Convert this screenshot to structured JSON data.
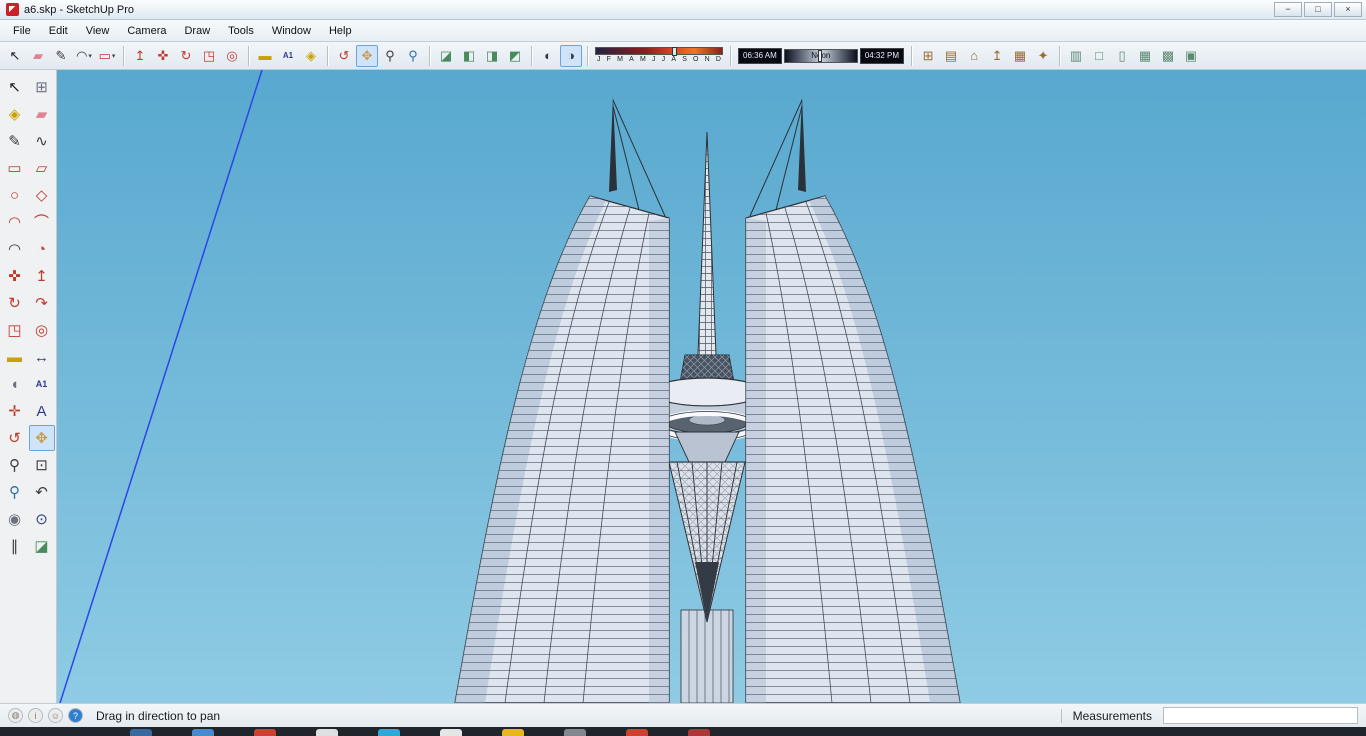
{
  "window": {
    "title": "a6.skp - SketchUp Pro",
    "controls": [
      {
        "name": "minimize",
        "glyph": "−"
      },
      {
        "name": "maximize",
        "glyph": "□"
      },
      {
        "name": "close",
        "glyph": "×"
      }
    ]
  },
  "menu": {
    "items": [
      "File",
      "Edit",
      "View",
      "Camera",
      "Draw",
      "Tools",
      "Window",
      "Help"
    ]
  },
  "toolbar_top": {
    "groups": [
      {
        "type": "buttons",
        "name": "draw",
        "buttons": [
          {
            "name": "select",
            "glyph": "↖",
            "color": "#1b1b1b"
          },
          {
            "name": "eraser",
            "glyph": "▰",
            "color": "#e08394"
          },
          {
            "name": "line",
            "glyph": "✎",
            "color": "#3a3a3a"
          },
          {
            "name": "arcs",
            "glyph": "◠",
            "color": "#3a3a3a",
            "dropdown": true
          },
          {
            "name": "shapes",
            "glyph": "▭",
            "color": "#c0392b",
            "dropdown": true
          }
        ]
      },
      {
        "type": "buttons",
        "name": "modify",
        "buttons": [
          {
            "name": "push-pull",
            "glyph": "↥",
            "color": "#c0392b"
          },
          {
            "name": "move",
            "glyph": "✜",
            "color": "#c0392b"
          },
          {
            "name": "rotate",
            "glyph": "↻",
            "color": "#c0392b"
          },
          {
            "name": "scale",
            "glyph": "◳",
            "color": "#c0392b"
          },
          {
            "name": "offset",
            "glyph": "◎",
            "color": "#c0392b"
          }
        ]
      },
      {
        "type": "buttons",
        "name": "construction",
        "buttons": [
          {
            "name": "tape-measure",
            "glyph": "▬",
            "color": "#c8a200"
          },
          {
            "name": "text",
            "glyph": "A1",
            "color": "#2d3b8e"
          },
          {
            "name": "paint-bucket",
            "glyph": "◈",
            "color": "#c8a200"
          }
        ]
      },
      {
        "type": "buttons",
        "name": "camera",
        "buttons": [
          {
            "name": "orbit",
            "glyph": "↺",
            "color": "#c0392b"
          },
          {
            "name": "pan",
            "glyph": "✥",
            "color": "#c99a4e",
            "active": true
          },
          {
            "name": "zoom",
            "glyph": "⚲",
            "color": "#3a3a3a"
          },
          {
            "name": "zoom-extents",
            "glyph": "⚲",
            "color": "#2d6cb0"
          }
        ]
      },
      {
        "type": "buttons",
        "name": "section",
        "buttons": [
          {
            "name": "section-plane",
            "glyph": "◪",
            "color": "#4a8a5c"
          },
          {
            "name": "display-section-planes",
            "glyph": "◧",
            "color": "#4a8a5c"
          },
          {
            "name": "display-section-cuts",
            "glyph": "◨",
            "color": "#4a8a5c"
          },
          {
            "name": "display-section-fill",
            "glyph": "◩",
            "color": "#4a8a5c"
          }
        ]
      },
      {
        "type": "buttons",
        "name": "shadows",
        "buttons": [
          {
            "name": "shadow-settings",
            "glyph": "◐",
            "color": "#30394a"
          },
          {
            "name": "toggle-shadows",
            "glyph": "◑",
            "color": "#30394a",
            "active": true
          }
        ]
      },
      {
        "type": "date",
        "name": "shadow-date"
      },
      {
        "type": "time",
        "name": "shadow-time"
      },
      {
        "type": "buttons",
        "name": "warehouse",
        "buttons": [
          {
            "name": "in-model-components",
            "glyph": "⊞",
            "color": "#9a6b2f"
          },
          {
            "name": "materials",
            "glyph": "▤",
            "color": "#9a6b2f"
          },
          {
            "name": "get-models",
            "glyph": "⌂",
            "color": "#9a6b2f"
          },
          {
            "name": "share-model",
            "glyph": "↥",
            "color": "#9a6b2f"
          },
          {
            "name": "send-to-layout",
            "glyph": "▦",
            "color": "#9a6b2f"
          },
          {
            "name": "extension-warehouse",
            "glyph": "✦",
            "color": "#9a6b2f"
          }
        ]
      },
      {
        "type": "buttons",
        "name": "styles",
        "buttons": [
          {
            "name": "x-ray",
            "glyph": "▥",
            "color": "#5b8a72"
          },
          {
            "name": "wireframe",
            "glyph": "□",
            "color": "#5b8a72"
          },
          {
            "name": "hidden-line",
            "glyph": "▯",
            "color": "#5b8a72"
          },
          {
            "name": "shaded",
            "glyph": "▦",
            "color": "#5b8a72"
          },
          {
            "name": "shaded-with-textures",
            "glyph": "▩",
            "color": "#5b8a72"
          },
          {
            "name": "monochrome",
            "glyph": "▣",
            "color": "#5b8a72"
          }
        ]
      }
    ],
    "shadow_date": {
      "months": [
        "J",
        "F",
        "M",
        "A",
        "M",
        "J",
        "J",
        "A",
        "S",
        "O",
        "N",
        "D"
      ]
    },
    "shadow_time": {
      "start": "06:36 AM",
      "noon": "Noon",
      "end": "04:32 PM"
    }
  },
  "tool_palette": {
    "tools": [
      {
        "name": "select",
        "glyph": "↖",
        "color": "#1b1b1b"
      },
      {
        "name": "make-component",
        "glyph": "⊞",
        "color": "#6b7280"
      },
      {
        "name": "paint-bucket",
        "glyph": "◈",
        "color": "#c8a200"
      },
      {
        "name": "eraser",
        "glyph": "▰",
        "color": "#e08394"
      },
      {
        "name": "line",
        "glyph": "✎",
        "color": "#3a3a3a"
      },
      {
        "name": "freehand",
        "glyph": "∿",
        "color": "#3a3a3a"
      },
      {
        "name": "rectangle",
        "glyph": "▭",
        "color": "#c0392b"
      },
      {
        "name": "rotated-rectangle",
        "glyph": "▱",
        "color": "#c0392b"
      },
      {
        "name": "circle",
        "glyph": "○",
        "color": "#c0392b"
      },
      {
        "name": "polygon",
        "glyph": "◇",
        "color": "#c0392b"
      },
      {
        "name": "arc",
        "glyph": "◠",
        "color": "#c0392b"
      },
      {
        "name": "two-point-arc",
        "glyph": "⌒",
        "color": "#c0392b"
      },
      {
        "name": "three-point-arc",
        "glyph": "◠",
        "color": "#3a3a3a"
      },
      {
        "name": "pie",
        "glyph": "◔",
        "color": "#c0392b"
      },
      {
        "name": "move",
        "glyph": "✜",
        "color": "#c0392b"
      },
      {
        "name": "push-pull",
        "glyph": "↥",
        "color": "#c0392b"
      },
      {
        "name": "rotate",
        "glyph": "↻",
        "color": "#c0392b"
      },
      {
        "name": "follow-me",
        "glyph": "↷",
        "color": "#c0392b"
      },
      {
        "name": "scale",
        "glyph": "◳",
        "color": "#c0392b"
      },
      {
        "name": "offset",
        "glyph": "◎",
        "color": "#c0392b"
      },
      {
        "name": "tape-measure",
        "glyph": "▬",
        "color": "#c8a200"
      },
      {
        "name": "dimension",
        "glyph": "↔",
        "color": "#2d3b8e"
      },
      {
        "name": "protractor",
        "glyph": "◖",
        "color": "#6b7280"
      },
      {
        "name": "text",
        "glyph": "A1",
        "color": "#2d3b8e"
      },
      {
        "name": "axes",
        "glyph": "✛",
        "color": "#c0392b"
      },
      {
        "name": "3d-text",
        "glyph": "A",
        "color": "#2d3b8e"
      },
      {
        "name": "orbit",
        "glyph": "↺",
        "color": "#c0392b"
      },
      {
        "name": "pan",
        "glyph": "✥",
        "color": "#c99a4e",
        "active": true
      },
      {
        "name": "zoom",
        "glyph": "⚲",
        "color": "#3a3a3a"
      },
      {
        "name": "zoom-window",
        "glyph": "⊡",
        "color": "#3a3a3a"
      },
      {
        "name": "zoom-extents",
        "glyph": "⚲",
        "color": "#2d6cb0"
      },
      {
        "name": "previous",
        "glyph": "↶",
        "color": "#3a3a3a"
      },
      {
        "name": "position-camera",
        "glyph": "◉",
        "color": "#6b7280"
      },
      {
        "name": "look-around",
        "glyph": "⊙",
        "color": "#2d3b8e"
      },
      {
        "name": "walk",
        "glyph": "∥",
        "color": "#3a3a3a"
      },
      {
        "name": "section-plane",
        "glyph": "◪",
        "color": "#4a8a5c"
      }
    ]
  },
  "statusbar": {
    "icons": [
      {
        "name": "geolocation",
        "glyph": "◍",
        "bg": "#ececec",
        "fg": "#7a7a7a"
      },
      {
        "name": "credits",
        "glyph": "i",
        "bg": "#ececec",
        "fg": "#7a7a7a"
      },
      {
        "name": "sign-in",
        "glyph": "☺",
        "bg": "#ececec",
        "fg": "#7a7a7a"
      },
      {
        "name": "help",
        "glyph": "?",
        "bg": "#2f7fd0",
        "fg": "#ffffff"
      }
    ],
    "hint": "Drag in direction to pan",
    "measurements_label": "Measurements",
    "measurements_value": ""
  },
  "taskbar": {
    "color": "#20242b",
    "items": [
      {
        "color": "#3a6ea5"
      },
      {
        "color": "#4a90d9"
      },
      {
        "color": "#d64533"
      },
      {
        "color": "#e8eaed"
      },
      {
        "color": "#30b0e0"
      },
      {
        "color": "#f0f0f0"
      },
      {
        "color": "#f2c11c"
      },
      {
        "color": "#888d94"
      },
      {
        "color": "#d64533"
      },
      {
        "color": "#b33a3a"
      }
    ]
  },
  "viewport": {
    "sky_top": "#58a8cf",
    "sky_bottom": "#8fcbe4",
    "axis_color": "#2a46e8"
  }
}
